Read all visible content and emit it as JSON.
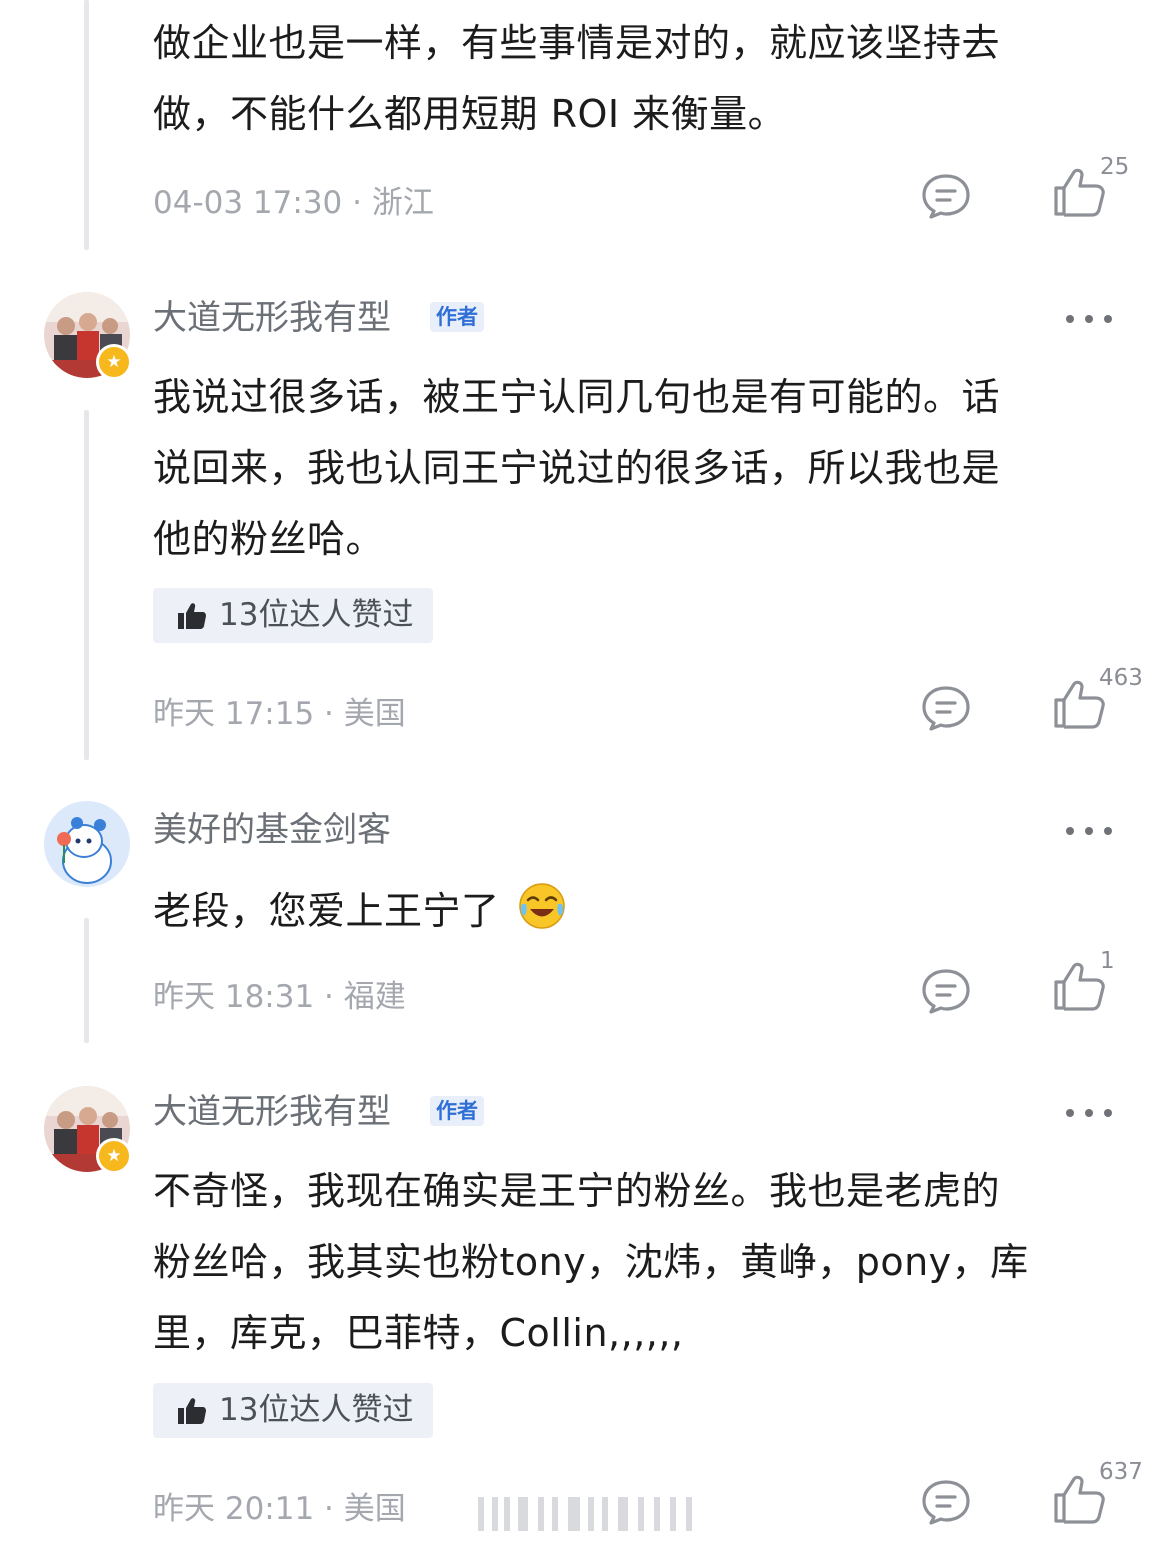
{
  "comments": [
    {
      "lines": [
        "做企业也是一样，有些事情是对的，就应该坚持去",
        "做，不能什么都用短期 ROI 来衡量。"
      ],
      "meta": "04-03 17:30 · 浙江",
      "like_count": "25"
    },
    {
      "username": "大道无形我有型",
      "author_tag": "作者",
      "lines": [
        "我说过很多话，被王宁认同几句也是有可能的。话",
        "说回来，我也认同王宁说过的很多话，所以我也是",
        "他的粉丝哈。"
      ],
      "liked_by": "13位达人赞过",
      "meta": "昨天 17:15 · 美国",
      "like_count": "463"
    },
    {
      "username": "美好的基金剑客",
      "lines": [
        "老段，您爱上王宁了"
      ],
      "emoji": "crying-laughing-emoji",
      "meta": "昨天 18:31 · 福建",
      "like_count": "1"
    },
    {
      "username": "大道无形我有型",
      "author_tag": "作者",
      "lines": [
        "不奇怪，我现在确实是王宁的粉丝。我也是老虎的",
        "粉丝哈，我其实也粉tony，沈炜，黄峥，pony，库",
        "里，库克，巴菲特，Collin,,,,,,"
      ],
      "liked_by": "13位达人赞过",
      "meta": "昨天 20:11 · 美国",
      "like_count": "637"
    }
  ],
  "colors": {
    "text": "#1c1c1c",
    "meta": "#a4a8ae",
    "username": "#6b6f76",
    "author_tag_text": "#2f6fd6",
    "author_tag_bg": "#e8effb",
    "chip_bg": "#edf1f7",
    "star_badge": "#f6b81c"
  },
  "icons": [
    "reply-icon",
    "thumb-up-icon",
    "more-icon",
    "star-badge-icon"
  ]
}
